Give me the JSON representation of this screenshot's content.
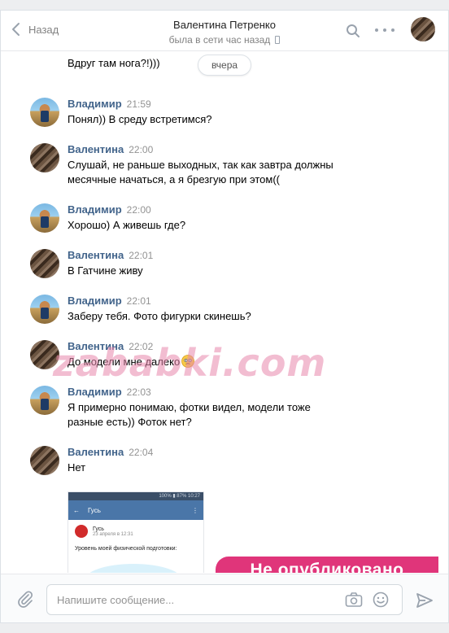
{
  "header": {
    "back_label": "Назад",
    "peer_name": "Валентина Петренко",
    "peer_status": "была в сети час назад"
  },
  "history": {
    "previous_text": "Вдруг там нога?!)))",
    "date_divider": "вчера",
    "messages": [
      {
        "author": "Владимир",
        "time": "21:59",
        "text": "Понял)) В среду встретимся?"
      },
      {
        "author": "Валентина",
        "time": "22:00",
        "text": "Слушай, не раньше выходных, так как завтра должны месячные начаться, а я брезгую при этом(("
      },
      {
        "author": "Владимир",
        "time": "22:00",
        "text": "Хорошо) А живешь где?"
      },
      {
        "author": "Валентина",
        "time": "22:01",
        "text": "В Гатчине живу"
      },
      {
        "author": "Владимир",
        "time": "22:01",
        "text": "Заберу тебя. Фото фигурки скинешь?"
      },
      {
        "author": "Валентина",
        "time": "22:02",
        "text": "До модели мне далеко"
      },
      {
        "author": "Владимир",
        "time": "22:03",
        "text": "Я примерно понимаю, фотки видел, модели тоже разные есть)) Фоток нет?"
      },
      {
        "author": "Валентина",
        "time": "22:04",
        "text": "Нет"
      }
    ],
    "attachment": {
      "statusbar": "100% ▮ 87% 10:27",
      "appbar_title": "Гусь",
      "post_author": "Гусь",
      "post_date": "23 апреля в 12:31",
      "post_text": "Уровень моей физической подготовки:"
    }
  },
  "watermark": "zababki.com",
  "banner": "Не опубликовано",
  "composer": {
    "placeholder": "Напишите сообщение..."
  },
  "colors": {
    "author": "#42648b",
    "accent": "#4a76a8",
    "banner": "#e0357a"
  }
}
